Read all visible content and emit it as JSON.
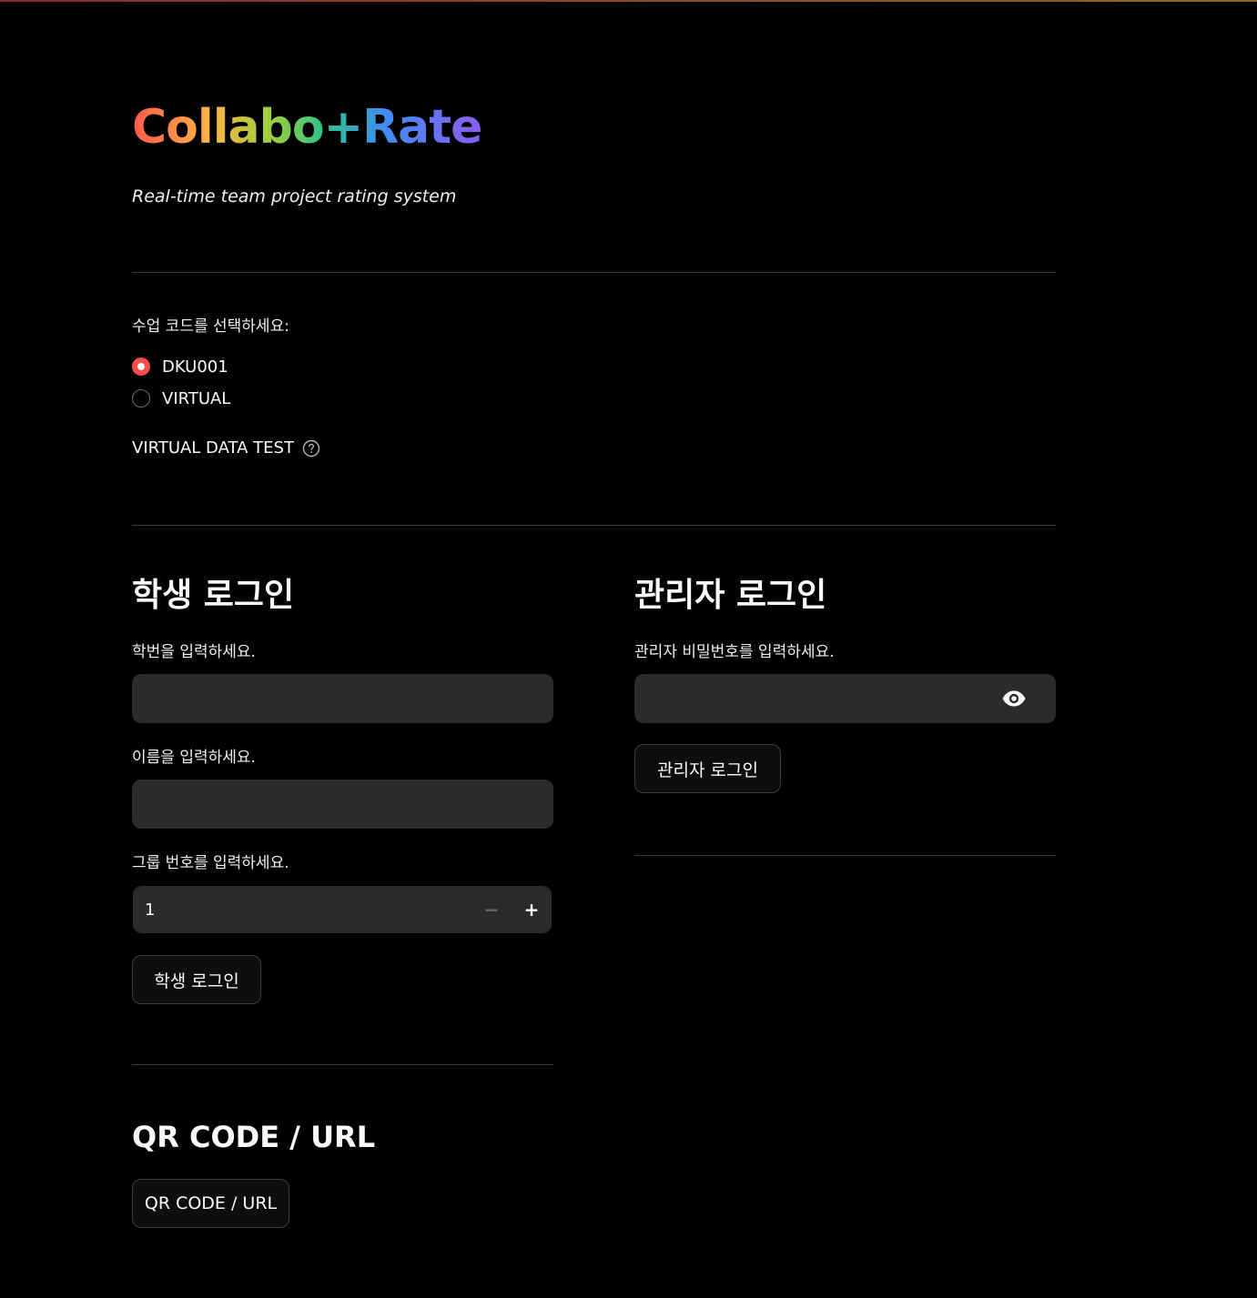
{
  "app": {
    "title": "Collabo+Rate",
    "subtitle": "Real-time team project rating system"
  },
  "course": {
    "prompt": "수업 코드를 선택하세요:",
    "options": [
      {
        "label": "DKU001",
        "selected": true
      },
      {
        "label": "VIRTUAL",
        "selected": false
      }
    ],
    "virtual_test_label": "VIRTUAL DATA TEST",
    "accent_color": "#ff4b4b"
  },
  "student": {
    "heading": "학생 로그인",
    "id_label": "학번을 입력하세요.",
    "id_value": "",
    "name_label": "이름을 입력하세요.",
    "name_value": "",
    "group_label": "그룹 번호를 입력하세요.",
    "group_value": "1",
    "minus_glyph": "−",
    "plus_glyph": "+",
    "login_button": "학생 로그인"
  },
  "admin": {
    "heading": "관리자 로그인",
    "password_label": "관리자 비밀번호를 입력하세요.",
    "password_value": "",
    "login_button": "관리자 로그인"
  },
  "qr": {
    "heading": "QR CODE / URL",
    "button": "QR CODE / URL"
  }
}
